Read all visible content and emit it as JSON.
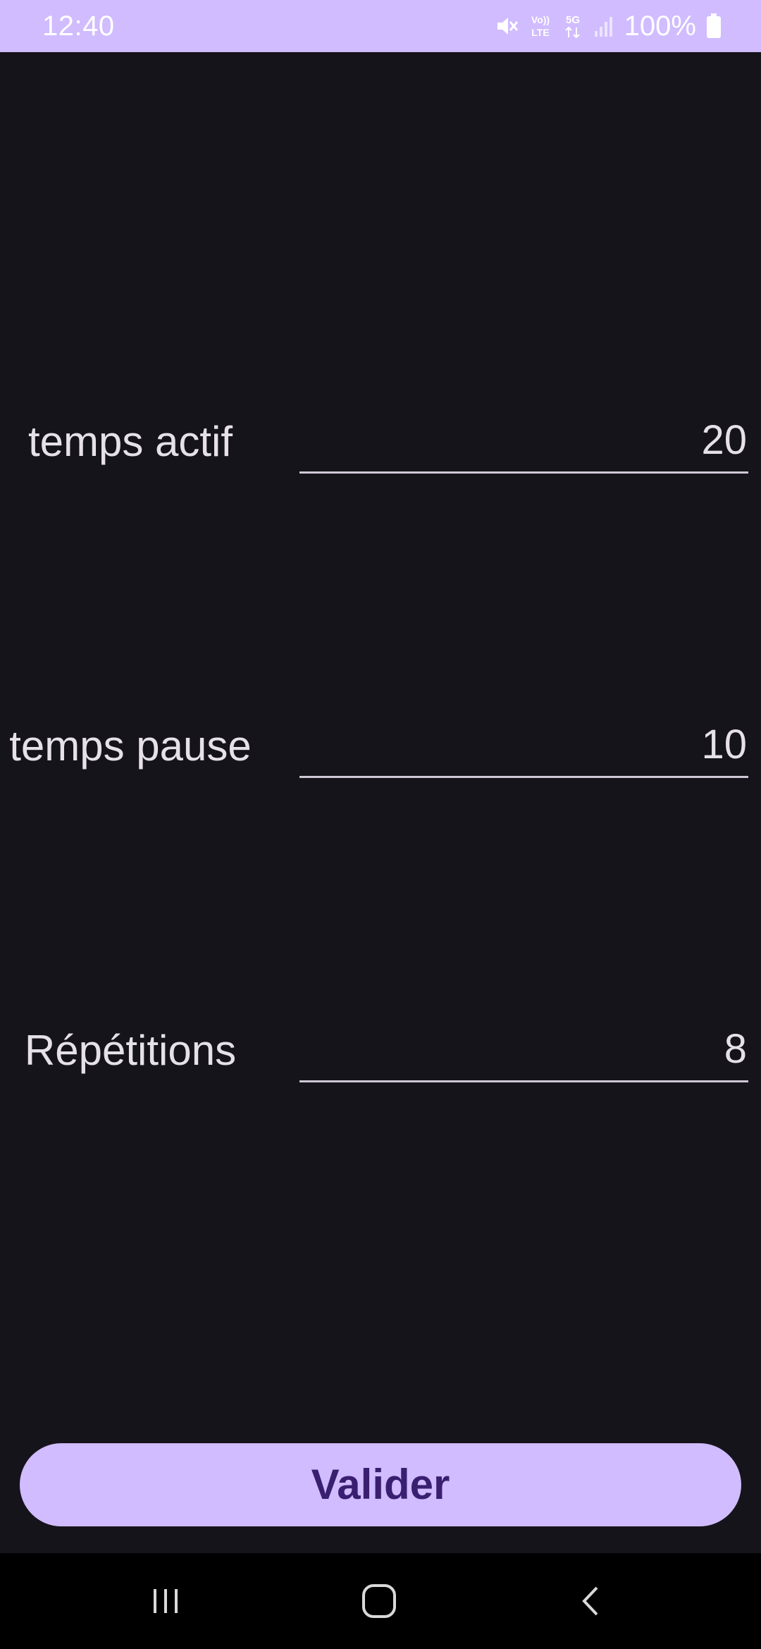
{
  "status_bar": {
    "time": "12:40",
    "volte_label": "Vo)) LTE",
    "network_label": "5G",
    "battery_percent": "100%"
  },
  "form": {
    "fields": [
      {
        "label": "temps actif",
        "value": "20"
      },
      {
        "label": "temps pause",
        "value": "10"
      },
      {
        "label": "Répétitions",
        "value": "8"
      }
    ],
    "submit_label": "Valider"
  },
  "nav_bar": {
    "recents_icon": "recents-icon",
    "home_icon": "home-icon",
    "back_icon": "back-icon"
  },
  "colors": {
    "accent": "#d0bcff",
    "background": "#16141b",
    "button_text": "#3a1f70"
  }
}
